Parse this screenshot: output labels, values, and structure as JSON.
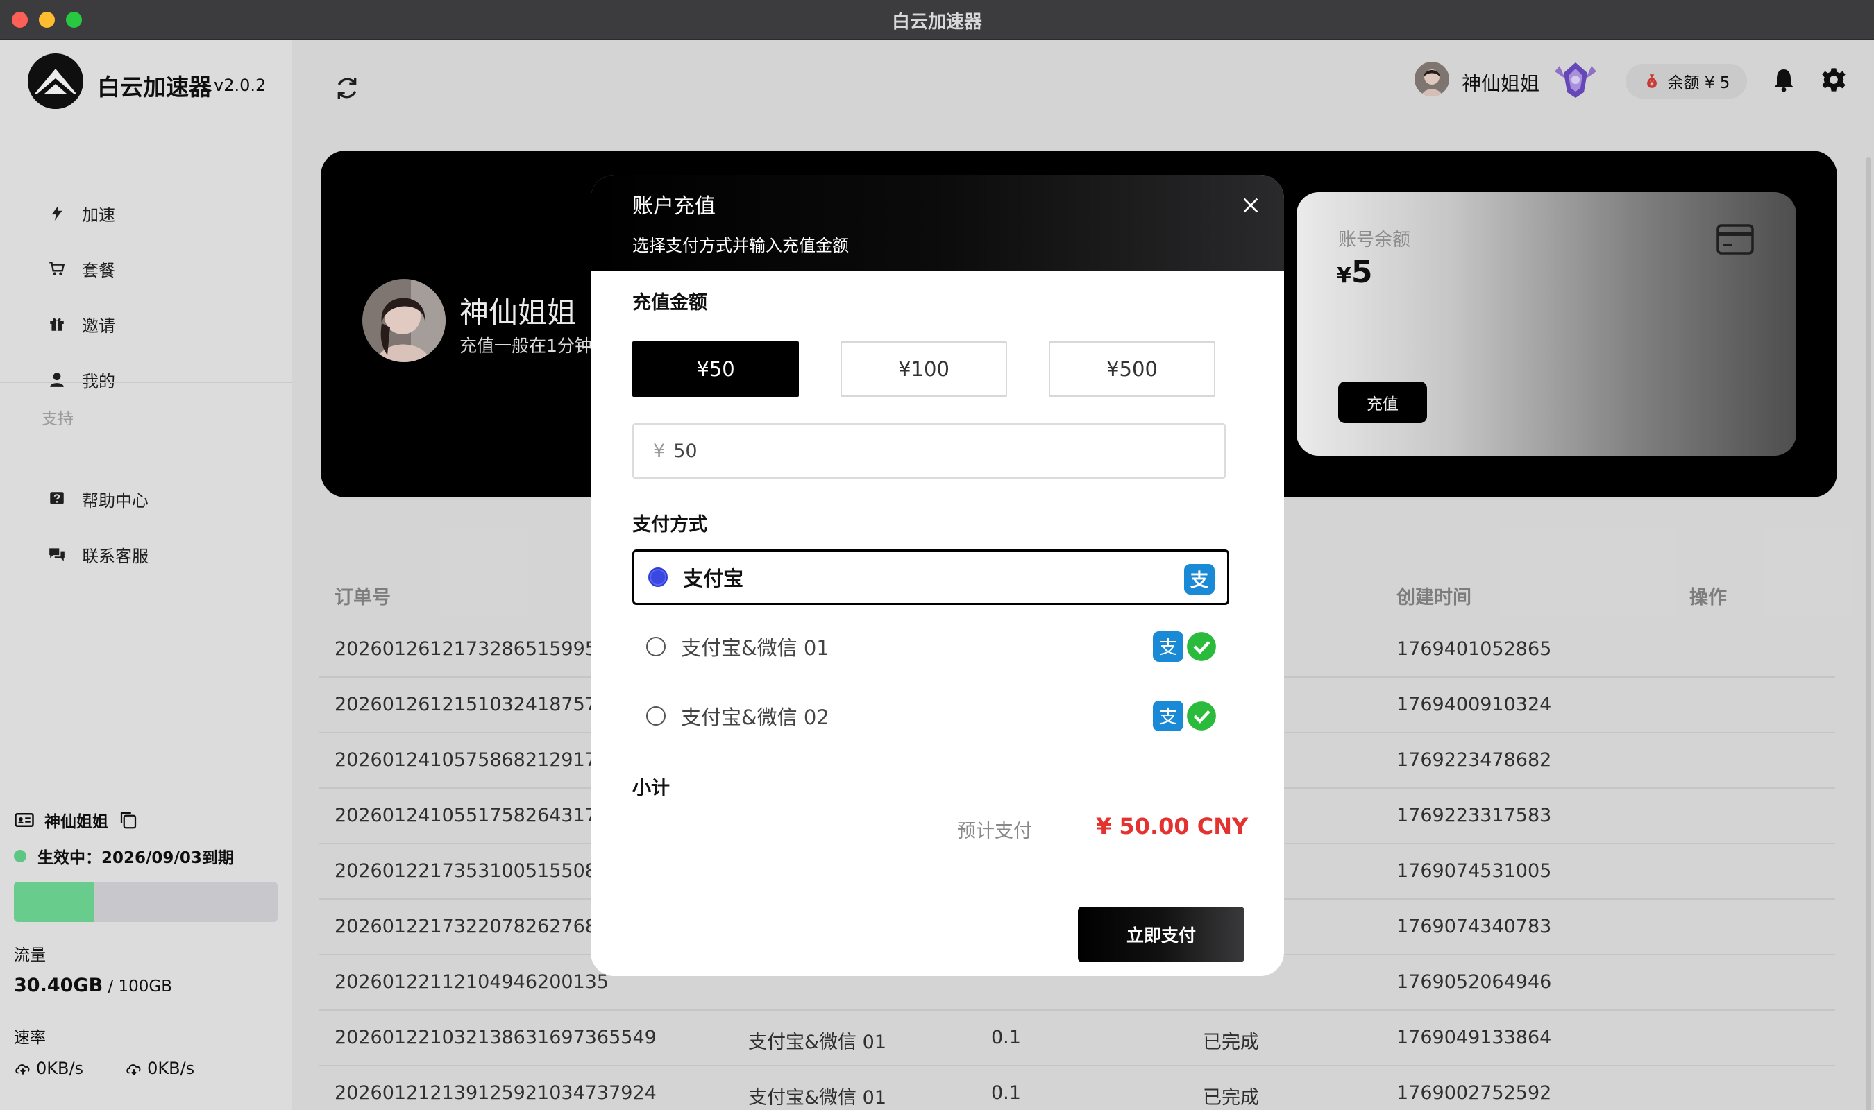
{
  "window": {
    "title": "白云加速器"
  },
  "app": {
    "name": "白云加速器",
    "version": "v2.0.2"
  },
  "sidebar": {
    "nav": [
      {
        "label": "加速",
        "icon": "bolt-icon"
      },
      {
        "label": "套餐",
        "icon": "cart-icon"
      },
      {
        "label": "邀请",
        "icon": "gift-icon"
      },
      {
        "label": "我的",
        "icon": "user-icon"
      }
    ],
    "support_label": "支持",
    "support": [
      {
        "label": "帮助中心",
        "icon": "help-icon"
      },
      {
        "label": "联系客服",
        "icon": "chat-icon"
      }
    ],
    "user": {
      "name": "神仙姐姐",
      "status": "生效中：2026/09/03到期",
      "usage_fraction": 0.304,
      "traffic_label": "流量",
      "traffic_used": "30.40GB",
      "traffic_sep": " / ",
      "traffic_total": "100GB",
      "speed_label": "速率",
      "upload": "0KB/s",
      "download": "0KB/s"
    }
  },
  "header": {
    "username": "神仙姐姐",
    "balance": "余额 ¥ 5"
  },
  "banner": {
    "name": "神仙姐姐",
    "subtitle": "充值一般在1分钟",
    "card": {
      "label": "账号余额",
      "currency": "¥",
      "amount": "5",
      "button": "充值"
    }
  },
  "table": {
    "headers": {
      "order": "订单号",
      "created": "创建时间",
      "action": "操作"
    },
    "rows": [
      {
        "order": "20260126121732865159951",
        "method": "",
        "amount": "",
        "status": "",
        "created": "1769401052865"
      },
      {
        "order": "20260126121510324187570",
        "method": "",
        "amount": "",
        "status": "",
        "created": "1769400910324"
      },
      {
        "order": "20260124105758682129170",
        "method": "",
        "amount": "",
        "status": "",
        "created": "1769223478682"
      },
      {
        "order": "20260124105517582643170",
        "method": "",
        "amount": "",
        "status": "",
        "created": "1769223317583"
      },
      {
        "order": "20260122173531005155083",
        "method": "",
        "amount": "",
        "status": "",
        "created": "1769074531005"
      },
      {
        "order": "20260122173220782627689",
        "method": "",
        "amount": "",
        "status": "",
        "created": "1769074340783"
      },
      {
        "order": "20260122112104946200135",
        "method": "",
        "amount": "",
        "status": "",
        "created": "1769052064946"
      },
      {
        "order": "20260122103213863169736554‌9",
        "method": "支付宝&微信 01",
        "amount": "0.1",
        "status": "已完成",
        "created": "1769049133864"
      },
      {
        "order": "202601212139125921034737924",
        "method": "支付宝&微信 01",
        "amount": "0.1",
        "status": "已完成",
        "created": "1769002752592"
      }
    ]
  },
  "modal": {
    "title": "账户充值",
    "subtitle": "选择支付方式并输入充值金额",
    "amount_label": "充值金额",
    "presets": [
      "¥50",
      "¥100",
      "¥500"
    ],
    "selected_preset": 0,
    "input_prefix": "¥",
    "input_value": "50",
    "method_label": "支付方式",
    "methods": [
      {
        "label": "支付宝",
        "icons": [
          "alipay-icon"
        ]
      },
      {
        "label": "支付宝&微信 01",
        "icons": [
          "alipay-icon",
          "wechat-icon"
        ]
      },
      {
        "label": "支付宝&微信 02",
        "icons": [
          "alipay-icon",
          "wechat-icon"
        ]
      }
    ],
    "selected_method": 0,
    "subtotal_label": "小计",
    "estimate_label": "预计支付",
    "estimate_value": "¥ 50.00 CNY",
    "pay_button": "立即支付"
  },
  "colors": {
    "accent_red": "#e3322f",
    "progress_green": "#71df98",
    "radio_blue": "#3a47e0",
    "alipay_blue": "#1b8ad6",
    "wechat_green": "#2bbb3c"
  }
}
